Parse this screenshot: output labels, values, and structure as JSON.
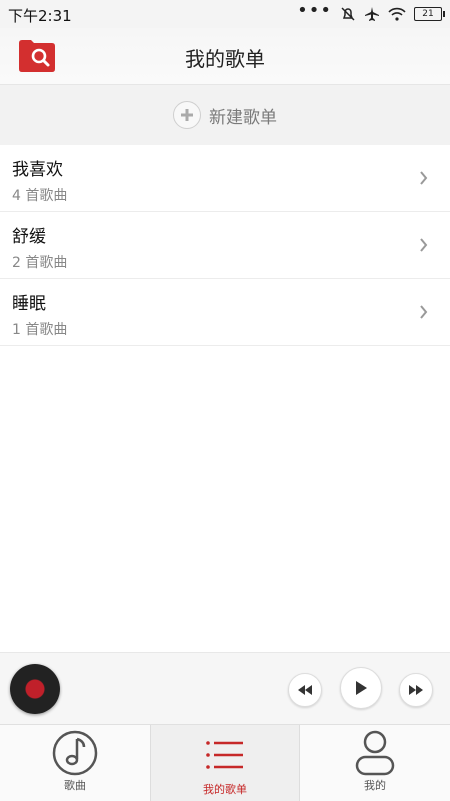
{
  "status_bar": {
    "time": "下午2:31",
    "battery": "21"
  },
  "header": {
    "title": "我的歌单"
  },
  "new_playlist": {
    "label": "新建歌单"
  },
  "playlists": [
    {
      "name": "我喜欢",
      "count": "4 首歌曲"
    },
    {
      "name": "舒缓",
      "count": "2 首歌曲"
    },
    {
      "name": "睡眠",
      "count": "1 首歌曲"
    }
  ],
  "tabs": [
    {
      "label": "歌曲",
      "icon": "music-note-icon"
    },
    {
      "label": "我的歌单",
      "icon": "list-icon",
      "active": true
    },
    {
      "label": "我的",
      "icon": "user-icon"
    }
  ],
  "colors": {
    "accent": "#c62828",
    "logo": "#d32f2f"
  }
}
